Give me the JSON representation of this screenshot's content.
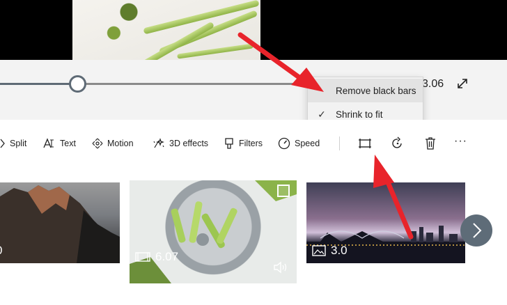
{
  "playback": {
    "time_end": "3.06"
  },
  "context_menu": {
    "items": [
      {
        "label": "Remove black bars",
        "checked": false,
        "highlighted": true
      },
      {
        "label": "Shrink to fit",
        "checked": true,
        "check_glyph": "✓"
      }
    ]
  },
  "toolbar": {
    "split": {
      "label": "Split",
      "icon": "split-icon"
    },
    "text": {
      "label": "Text",
      "icon": "text-icon"
    },
    "motion": {
      "label": "Motion",
      "icon": "motion-icon"
    },
    "effects3d": {
      "label": "3D effects",
      "icon": "3d-effects-icon"
    },
    "filters": {
      "label": "Filters",
      "icon": "filters-icon"
    },
    "speed": {
      "label": "Speed",
      "icon": "speed-icon"
    },
    "resize_icon": "resize-icon",
    "rotate_icon": "rotate-icon",
    "delete_icon": "trash-icon",
    "more": "···"
  },
  "storyboard": {
    "clips": [
      {
        "duration": "0",
        "type": "image"
      },
      {
        "duration": "6.07",
        "type": "video",
        "selected": true
      },
      {
        "duration": "3.0",
        "type": "image"
      }
    ]
  },
  "annotations": {
    "arrow_color": "#e8242b"
  }
}
